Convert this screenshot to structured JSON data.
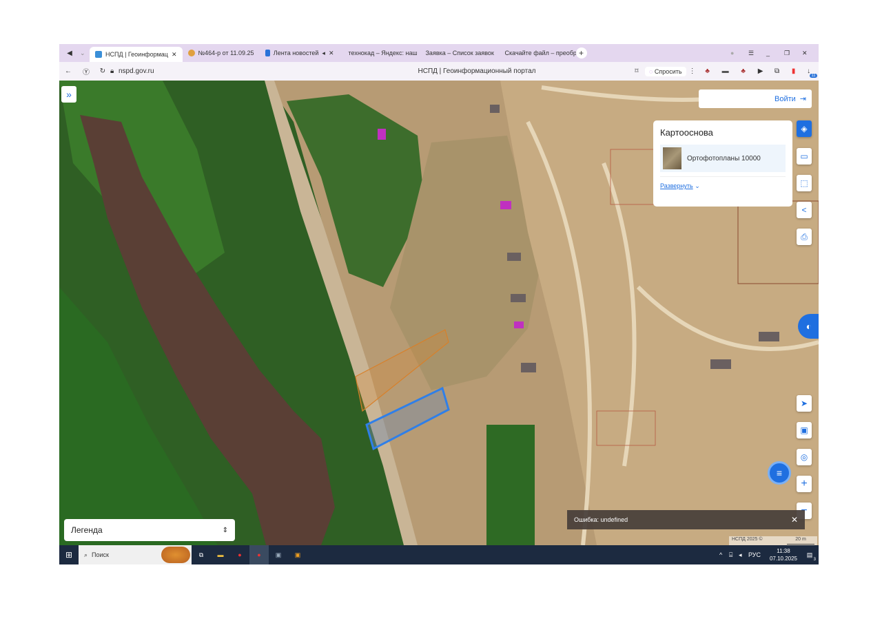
{
  "browser": {
    "tabs": [
      {
        "label": "НСПД | Геоинформац",
        "active": true,
        "color": "#3a8fd8"
      },
      {
        "label": "№464-р от 11.09.25",
        "active": false,
        "color": "#e0a040"
      },
      {
        "label": "Лента новостей",
        "active": false,
        "color": "#2a72d8"
      },
      {
        "label": "технокад – Яндекс: наш",
        "active": false,
        "color": "#e04a2a"
      },
      {
        "label": "Заявка – Список заявок",
        "active": false,
        "color": "#6a9a3a"
      },
      {
        "label": "Скачайте файл – преобр",
        "active": false,
        "color": "#1e7a3a"
      }
    ],
    "new_tab": "+",
    "url": "nspd.gov.ru",
    "page_title": "НСПД | Геоинформационный портал",
    "ask_label": "Спросить",
    "downloads_badge": "11"
  },
  "map": {
    "login_label": "Войти",
    "basemap_panel": {
      "title": "Картооснова",
      "layer": "Ортофотопланы 10000",
      "expand_label": "Развернуть"
    },
    "legend_label": "Легенда",
    "error_toast": "Ошибка: undefined",
    "attribution": "НСПД 2025 ©",
    "scale": "20 m"
  },
  "taskbar": {
    "search_placeholder": "Поиск",
    "lang": "РУС",
    "time": "11:38",
    "date": "07.10.2025",
    "notif_count": "3"
  },
  "colors": {
    "accent": "#1f6fe0",
    "tabbar": "#e4d7ef",
    "taskbar": "#1c2a40",
    "selected_parcel": "#2f7fe8"
  }
}
